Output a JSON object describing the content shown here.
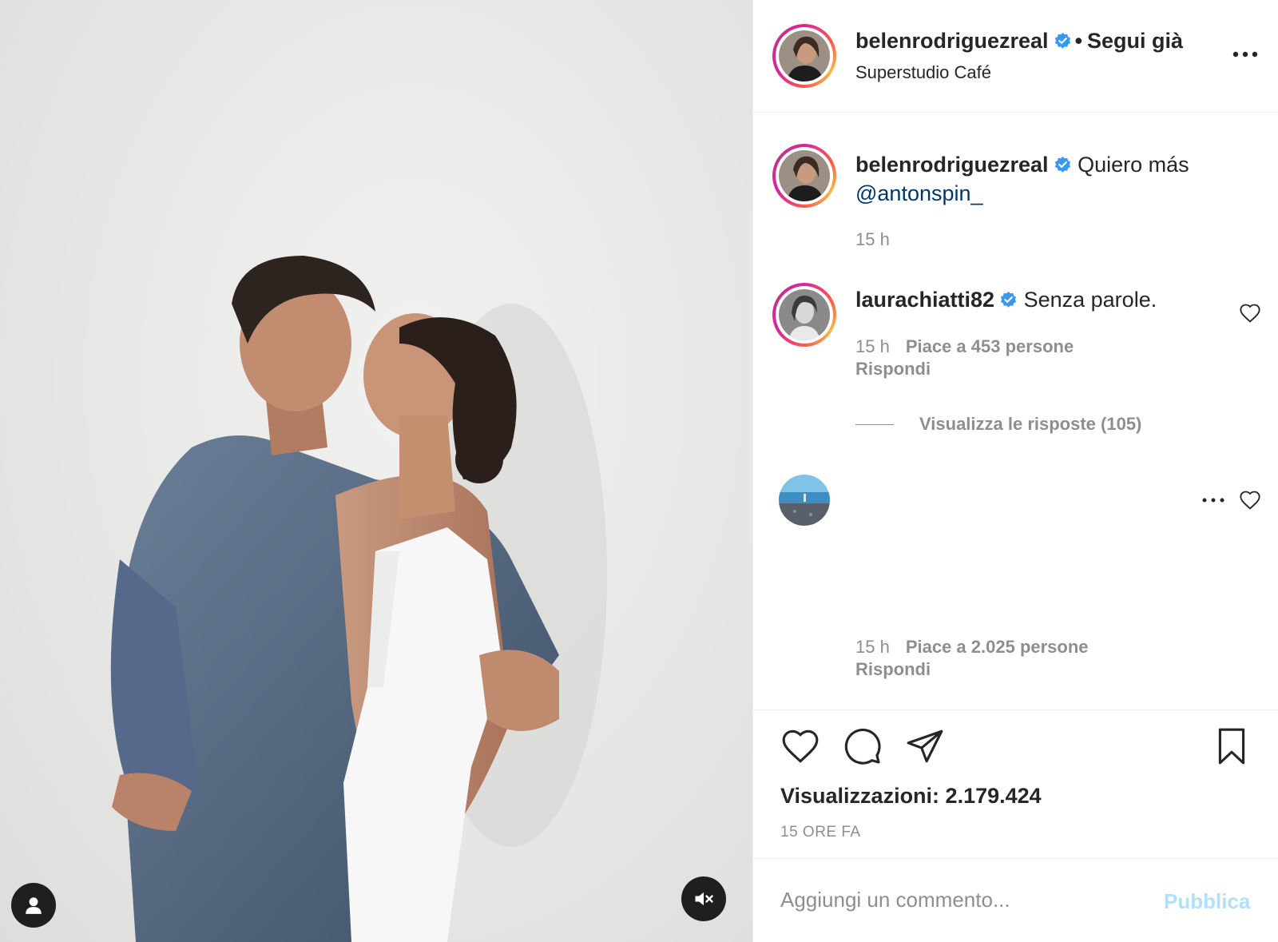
{
  "post": {
    "author": "belenrodriguezreal",
    "follow_status": "Segui già",
    "separator": "•",
    "location": "Superstudio Café",
    "caption_text": "Quiero más",
    "caption_mention": "@antonspin_",
    "caption_time": "15 h"
  },
  "comments": [
    {
      "username": "laurachiatti82",
      "text": "Senza parole.",
      "time": "15 h",
      "likes": "Piace a 453 persone",
      "reply": "Rispondi",
      "view_replies": "Visualizza le risposte (105)"
    },
    {
      "username": "",
      "text": "",
      "time": "15 h",
      "likes": "Piace a 2.025 persone",
      "reply": "Rispondi"
    }
  ],
  "stats": {
    "views": "Visualizzazioni: 2.179.424",
    "time_ago": "15 ORE FA"
  },
  "composer": {
    "placeholder": "Aggiungi un commento...",
    "publish_label": "Pubblica"
  },
  "icons": {
    "more": "more-horizontal-icon",
    "verified": "verified-badge-icon",
    "like": "heart-icon",
    "comment": "comment-bubble-icon",
    "share": "paper-plane-icon",
    "save": "bookmark-icon",
    "user_tag": "user-icon",
    "mute": "speaker-muted-icon"
  },
  "colors": {
    "verified": "#3897f0",
    "link": "#00376b",
    "secondary_text": "#8e8e8e",
    "publish_disabled": "#b2dffc"
  }
}
